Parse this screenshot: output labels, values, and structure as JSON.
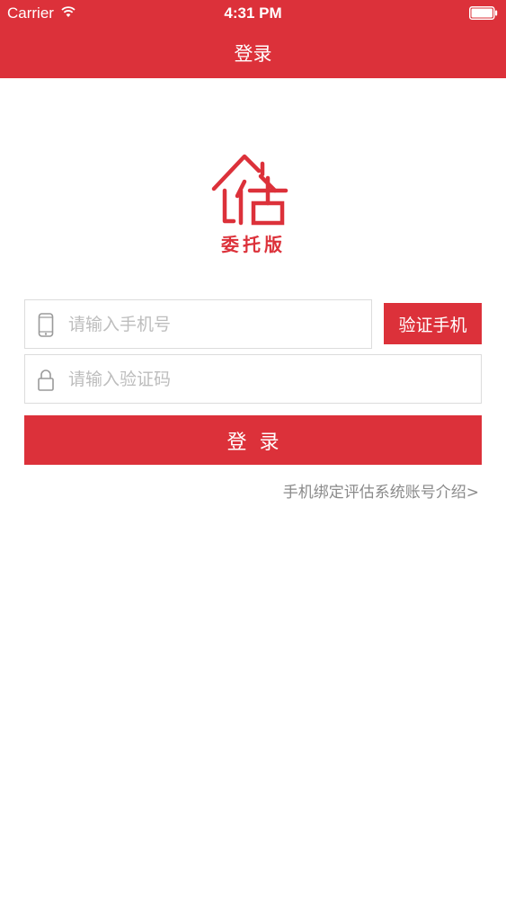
{
  "status_bar": {
    "carrier": "Carrier",
    "time": "4:31 PM",
    "icons": [
      "wifi-icon",
      "battery-icon"
    ]
  },
  "nav": {
    "title": "登录"
  },
  "logo": {
    "glyph": "估",
    "caption": "委托版"
  },
  "form": {
    "phone_placeholder": "请输入手机号",
    "phone_icon": "phone-icon",
    "verify_button_label": "验证手机",
    "code_placeholder": "请输入验证码",
    "code_icon": "lock-icon",
    "login_button_label": "登录"
  },
  "intro_link": "手机绑定评估系统账号介绍>",
  "colors": {
    "brand": "#dc313a",
    "field_border": "#dcdcdc",
    "placeholder": "#bdbdbd",
    "link": "#8a8a8a",
    "background": "#ffffff"
  }
}
